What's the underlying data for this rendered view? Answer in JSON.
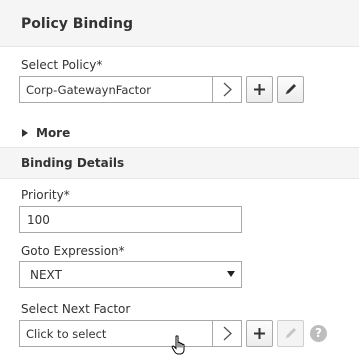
{
  "header": {
    "title": "Policy Binding"
  },
  "select_policy": {
    "label": "Select Policy*",
    "value": "Corp-GatewaynFactor"
  },
  "more": {
    "label": "More"
  },
  "binding_details": {
    "title": "Binding Details",
    "priority": {
      "label": "Priority*",
      "value": "100"
    },
    "goto_expression": {
      "label": "Goto Expression*",
      "value": "NEXT"
    },
    "next_factor": {
      "label": "Select Next Factor",
      "placeholder": "Click to select"
    }
  },
  "help": {
    "symbol": "?"
  },
  "icons": {
    "select_arrow": "chevron-right-icon",
    "add": "plus-icon",
    "edit": "pencil-icon",
    "expand": "triangle-right-icon",
    "dropdown": "caret-down-icon",
    "cursor": "hand-pointer-icon"
  },
  "colors": {
    "header_bg": "#f5f5f5",
    "border": "#aaaaaa",
    "text": "#333333",
    "disabled_icon": "#bdbdbd"
  }
}
